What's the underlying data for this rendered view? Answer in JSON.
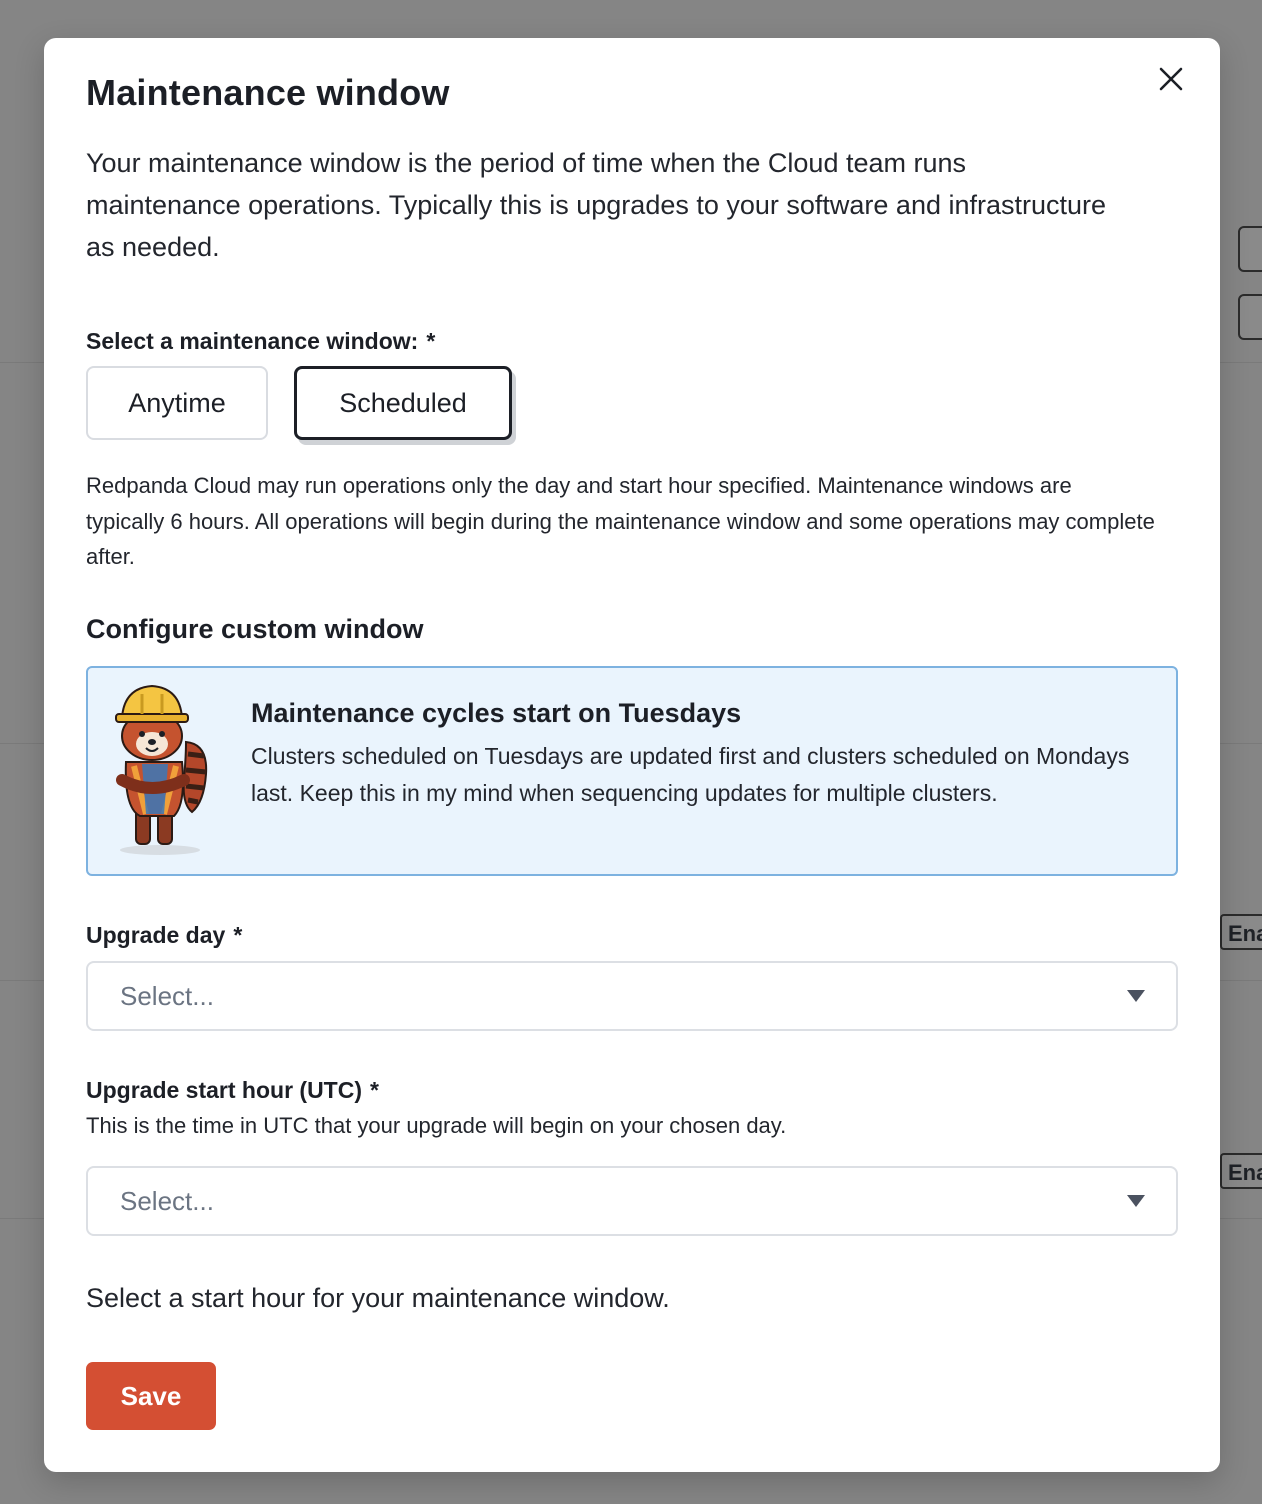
{
  "modal": {
    "title": "Maintenance window",
    "intro": "Your maintenance window is the period of time when the Cloud team runs maintenance operations. Typically this is upgrades to your software and infrastructure as needed.",
    "window_label": "Select a maintenance window:",
    "required_mark": "*",
    "options": [
      "Anytime",
      "Scheduled"
    ],
    "selected_option": "Scheduled",
    "helper_text": "Redpanda Cloud may run operations only the day and start hour specified. Maintenance windows are typically 6 hours. All operations will begin during the maintenance window and some operations may complete after.",
    "section_title": "Configure custom window",
    "info": {
      "title": "Maintenance cycles start on Tuesdays",
      "body": "Clusters scheduled on Tuesdays are updated first and clusters scheduled on Mondays last. Keep this in my mind when sequencing updates for multiple clusters."
    },
    "upgrade_day": {
      "label": "Upgrade day",
      "placeholder": "Select..."
    },
    "upgrade_hour": {
      "label": "Upgrade start hour (UTC)",
      "help": "This is the time in UTC that your upgrade will begin on your chosen day.",
      "placeholder": "Select..."
    },
    "validation_message": "Select a start hour for your maintenance window.",
    "save_label": "Save"
  },
  "background": {
    "tag_labels": [
      "Ena",
      "Ena"
    ]
  },
  "colors": {
    "overlay": "#858585",
    "accent_save": "#d44f33",
    "info_bg": "#eaf4fd",
    "info_border": "#7db2e0"
  }
}
